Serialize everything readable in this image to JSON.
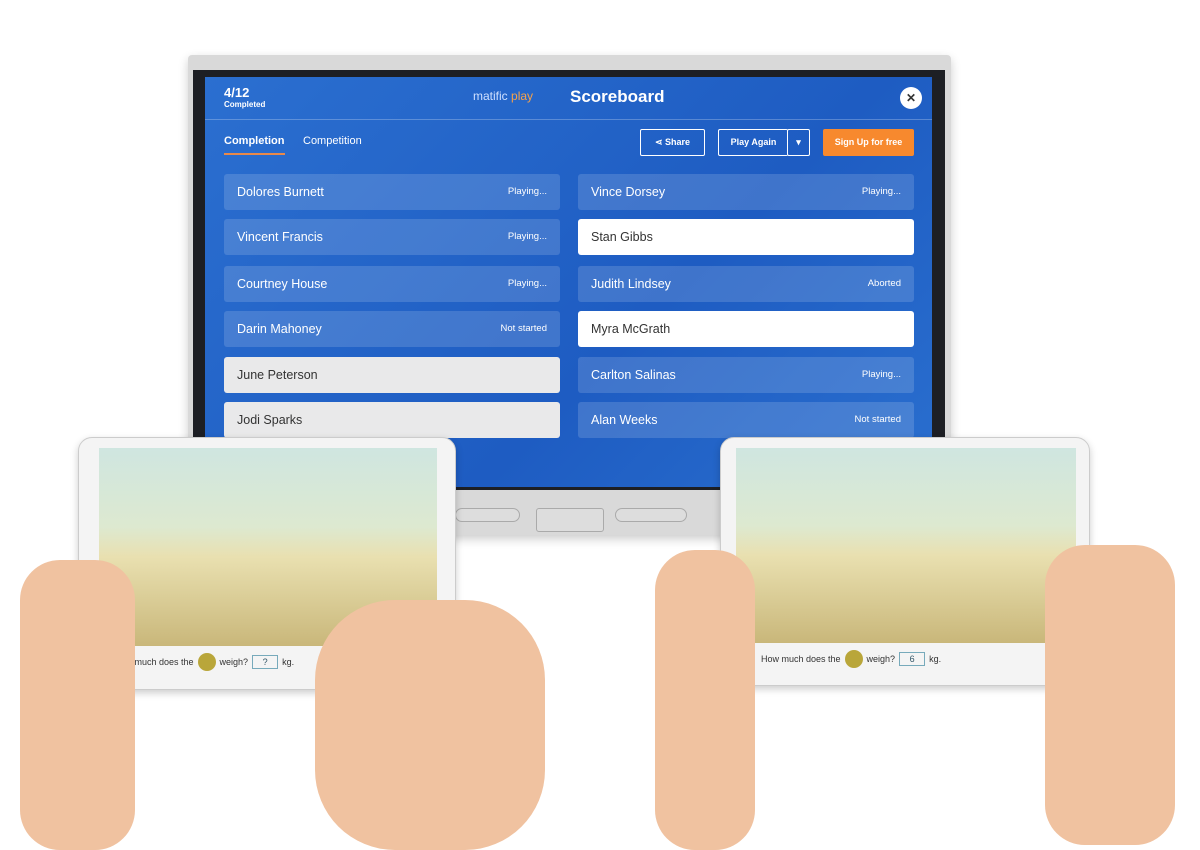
{
  "header": {
    "completed_count": "4/12",
    "completed_label": "Completed",
    "brand": "matific",
    "brand_play": "play",
    "title": "Scoreboard",
    "close_icon": "close-icon"
  },
  "tabs": [
    {
      "label": "Completion",
      "active": true
    },
    {
      "label": "Competition",
      "active": false
    }
  ],
  "buttons": {
    "share": "Share",
    "play_again": "Play Again",
    "signup": "Sign Up for free"
  },
  "colors": {
    "accent": "#f7892e",
    "screen": "#2468cc"
  },
  "players": [
    {
      "name": "Dolores Burnett",
      "status": "Playing..."
    },
    {
      "name": "Vince Dorsey",
      "status": "Playing..."
    },
    {
      "name": "Vincent Francis",
      "status": "Playing..."
    },
    {
      "name": "Stan Gibbs",
      "status": ""
    },
    {
      "name": "Courtney House",
      "status": "Playing..."
    },
    {
      "name": "Judith Lindsey",
      "status": "Aborted"
    },
    {
      "name": "Darin Mahoney",
      "status": "Not started"
    },
    {
      "name": "Myra McGrath",
      "status": ""
    },
    {
      "name": "June Peterson",
      "status": ""
    },
    {
      "name": "Carlton Salinas",
      "status": "Playing..."
    },
    {
      "name": "Jodi Sparks",
      "status": ""
    },
    {
      "name": "Alan Weeks",
      "status": "Not started"
    }
  ],
  "tablets": [
    {
      "question": "How much does the",
      "question_end": "weigh?",
      "answer": "?",
      "unit": "kg."
    },
    {
      "question": "How much does the",
      "question_end": "weigh?",
      "answer": "6",
      "unit": "kg."
    }
  ]
}
